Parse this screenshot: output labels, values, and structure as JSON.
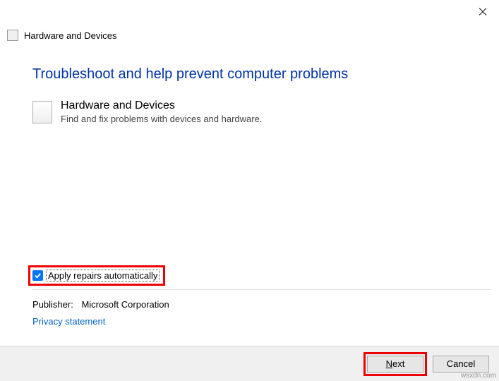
{
  "title": "Hardware and Devices",
  "heading": "Troubleshoot and help prevent computer problems",
  "item": {
    "title": "Hardware and Devices",
    "desc": "Find and fix problems with devices and hardware."
  },
  "checkbox": {
    "label": "Apply repairs automatically",
    "checked": true
  },
  "publisher": {
    "label": "Publisher:",
    "name": "Microsoft Corporation"
  },
  "privacy_link": "Privacy statement",
  "buttons": {
    "next_prefix": "N",
    "next_rest": "ext",
    "cancel": "Cancel"
  },
  "watermark": "wsxdn.com"
}
